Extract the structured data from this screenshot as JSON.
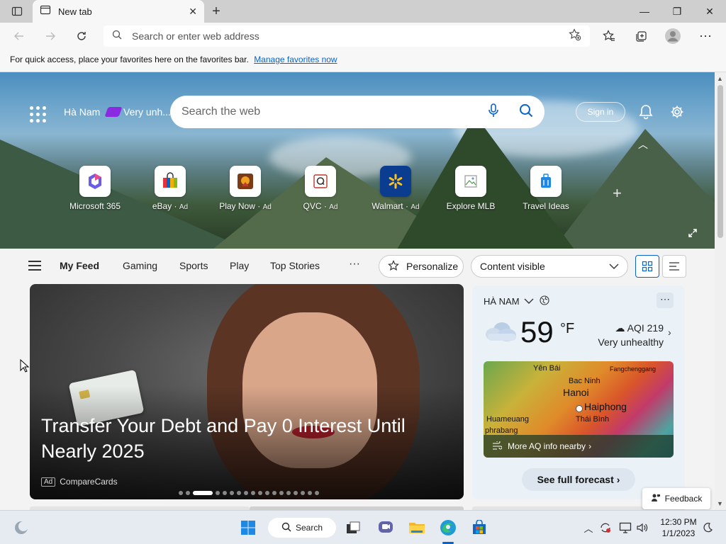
{
  "browser": {
    "tab_title": "New tab",
    "address_placeholder": "Search or enter web address",
    "favorites_bar_text": "For quick access, place your favorites here on the favorites bar.",
    "favorites_bar_link": "Manage favorites now"
  },
  "hero": {
    "location": "Hà Nam",
    "aqi_status_short": "Very unh...",
    "search_placeholder": "Search the web",
    "signin_label": "Sign in",
    "tiles": [
      {
        "label": "Microsoft 365",
        "ad": ""
      },
      {
        "label": "eBay",
        "ad": "Ad"
      },
      {
        "label": "Play Now",
        "ad": "Ad"
      },
      {
        "label": "QVC",
        "ad": "Ad"
      },
      {
        "label": "Walmart",
        "ad": "Ad"
      },
      {
        "label": "Explore MLB",
        "ad": ""
      },
      {
        "label": "Travel Ideas",
        "ad": ""
      }
    ]
  },
  "feed": {
    "tabs": [
      "My Feed",
      "Gaming",
      "Sports",
      "Play",
      "Top Stories"
    ],
    "more": "···",
    "personalize": "Personalize",
    "content_visibility": "Content visible"
  },
  "hero_card": {
    "title": "Transfer Your Debt and Pay 0 Interest Until Nearly 2025",
    "ad_tag": "Ad",
    "source": "CompareCards",
    "carousel_count": 18,
    "carousel_active": 2
  },
  "weather": {
    "location": "HÀ NAM",
    "temperature": "59",
    "unit": "°F",
    "aqi_label": "AQI 219",
    "aqi_status": "Very unhealthy",
    "map_labels": [
      "Yên Bái",
      "Fangchenggang",
      "Bac Ninh",
      "Hanoi",
      "Haiphong",
      "Huameuang",
      "Thái Bình",
      "phrabang"
    ],
    "map_link": "More AQ info nearby",
    "forecast_button": "See full forecast"
  },
  "feedback_label": "Feedback",
  "taskbar": {
    "search_label": "Search",
    "time": "12:30 PM",
    "date": "1/1/2023"
  },
  "colors": {
    "accent": "#0a63c9",
    "aqi_purple": "#8a2be2"
  }
}
